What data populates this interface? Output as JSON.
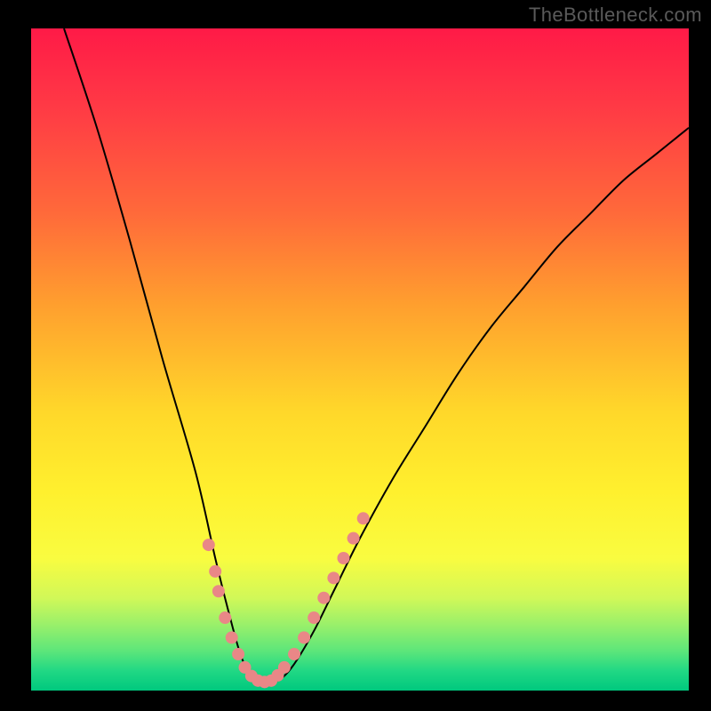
{
  "watermark": "TheBottleneck.com",
  "colors": {
    "background_black": "#000000",
    "curve": "#000000",
    "marker": "#e98787",
    "gradient_top": "#ff1a47",
    "gradient_bottom": "#00c87e"
  },
  "chart_data": {
    "type": "line",
    "title": "",
    "xlabel": "",
    "ylabel": "",
    "xlim": [
      0,
      100
    ],
    "ylim": [
      0,
      100
    ],
    "curve": {
      "description": "V-shaped bottleneck curve; minimum near x≈35, asymmetric (steeper on the left).",
      "points": [
        {
          "x": 5,
          "y": 100
        },
        {
          "x": 10,
          "y": 85
        },
        {
          "x": 15,
          "y": 68
        },
        {
          "x": 20,
          "y": 50
        },
        {
          "x": 25,
          "y": 33
        },
        {
          "x": 28,
          "y": 20
        },
        {
          "x": 30,
          "y": 12
        },
        {
          "x": 32,
          "y": 5
        },
        {
          "x": 34,
          "y": 1.5
        },
        {
          "x": 36,
          "y": 1.2
        },
        {
          "x": 38,
          "y": 1.8
        },
        {
          "x": 40,
          "y": 4
        },
        {
          "x": 43,
          "y": 9
        },
        {
          "x": 46,
          "y": 15
        },
        {
          "x": 50,
          "y": 23
        },
        {
          "x": 55,
          "y": 32
        },
        {
          "x": 60,
          "y": 40
        },
        {
          "x": 65,
          "y": 48
        },
        {
          "x": 70,
          "y": 55
        },
        {
          "x": 75,
          "y": 61
        },
        {
          "x": 80,
          "y": 67
        },
        {
          "x": 85,
          "y": 72
        },
        {
          "x": 90,
          "y": 77
        },
        {
          "x": 95,
          "y": 81
        },
        {
          "x": 100,
          "y": 85
        }
      ],
      "stroke_width": 2
    },
    "markers": {
      "description": "Highlighted sample points (salmon dots) clustered around the valley and lower slopes.",
      "radius_px": 7,
      "points": [
        {
          "x": 27,
          "y": 22
        },
        {
          "x": 28,
          "y": 18
        },
        {
          "x": 28.5,
          "y": 15
        },
        {
          "x": 29.5,
          "y": 11
        },
        {
          "x": 30.5,
          "y": 8
        },
        {
          "x": 31.5,
          "y": 5.5
        },
        {
          "x": 32.5,
          "y": 3.5
        },
        {
          "x": 33.5,
          "y": 2.2
        },
        {
          "x": 34.5,
          "y": 1.5
        },
        {
          "x": 35.5,
          "y": 1.3
        },
        {
          "x": 36.5,
          "y": 1.5
        },
        {
          "x": 37.5,
          "y": 2.3
        },
        {
          "x": 38.5,
          "y": 3.5
        },
        {
          "x": 40,
          "y": 5.5
        },
        {
          "x": 41.5,
          "y": 8
        },
        {
          "x": 43,
          "y": 11
        },
        {
          "x": 44.5,
          "y": 14
        },
        {
          "x": 46,
          "y": 17
        },
        {
          "x": 47.5,
          "y": 20
        },
        {
          "x": 49,
          "y": 23
        },
        {
          "x": 50.5,
          "y": 26
        }
      ]
    }
  }
}
